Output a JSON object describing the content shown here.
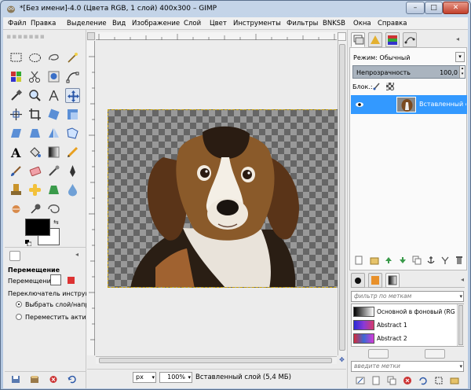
{
  "window": {
    "title": "*[Без имени]-4.0 (Цвета RGB, 1 слой) 400x300 – GIMP",
    "buttons": {
      "minimize": "–",
      "maximize": "□",
      "close": "✕"
    }
  },
  "menu": [
    "Файл",
    "Правка",
    "Выделение",
    "Вид",
    "Изображение",
    "Слой",
    "Цвет",
    "Инструменты",
    "Фильтры",
    "BNKSB",
    "Окна",
    "Справка"
  ],
  "tool_options": {
    "title": "Перемещение",
    "move_label": "Перемещение:",
    "switch_label": "Переключатель инструмент",
    "radio_1": "Выбрать слой/направ",
    "radio_2": "Переместить активн"
  },
  "canvas": {
    "unit": "px",
    "zoom": "100%",
    "status": "Вставленный слой (5,4 МБ)",
    "zoom_corner_icon": "✥"
  },
  "layers": {
    "mode_label": "Режим: Обычный",
    "opacity_label": "Непрозрачность",
    "opacity_value": "100,0",
    "lock_label": "Блок.:",
    "layer_name": "Вставленный слой"
  },
  "gradients": {
    "filter_placeholder": "фильтр по меткам",
    "items": [
      {
        "name": "Основной в фоновый (RGB)"
      },
      {
        "name": "Abstract 1"
      },
      {
        "name": "Abstract 2"
      }
    ],
    "tag_placeholder": "введите метки"
  },
  "colors": {
    "accent_selection": "#3399ff",
    "foreground": "#000000",
    "background": "#ffffff"
  }
}
